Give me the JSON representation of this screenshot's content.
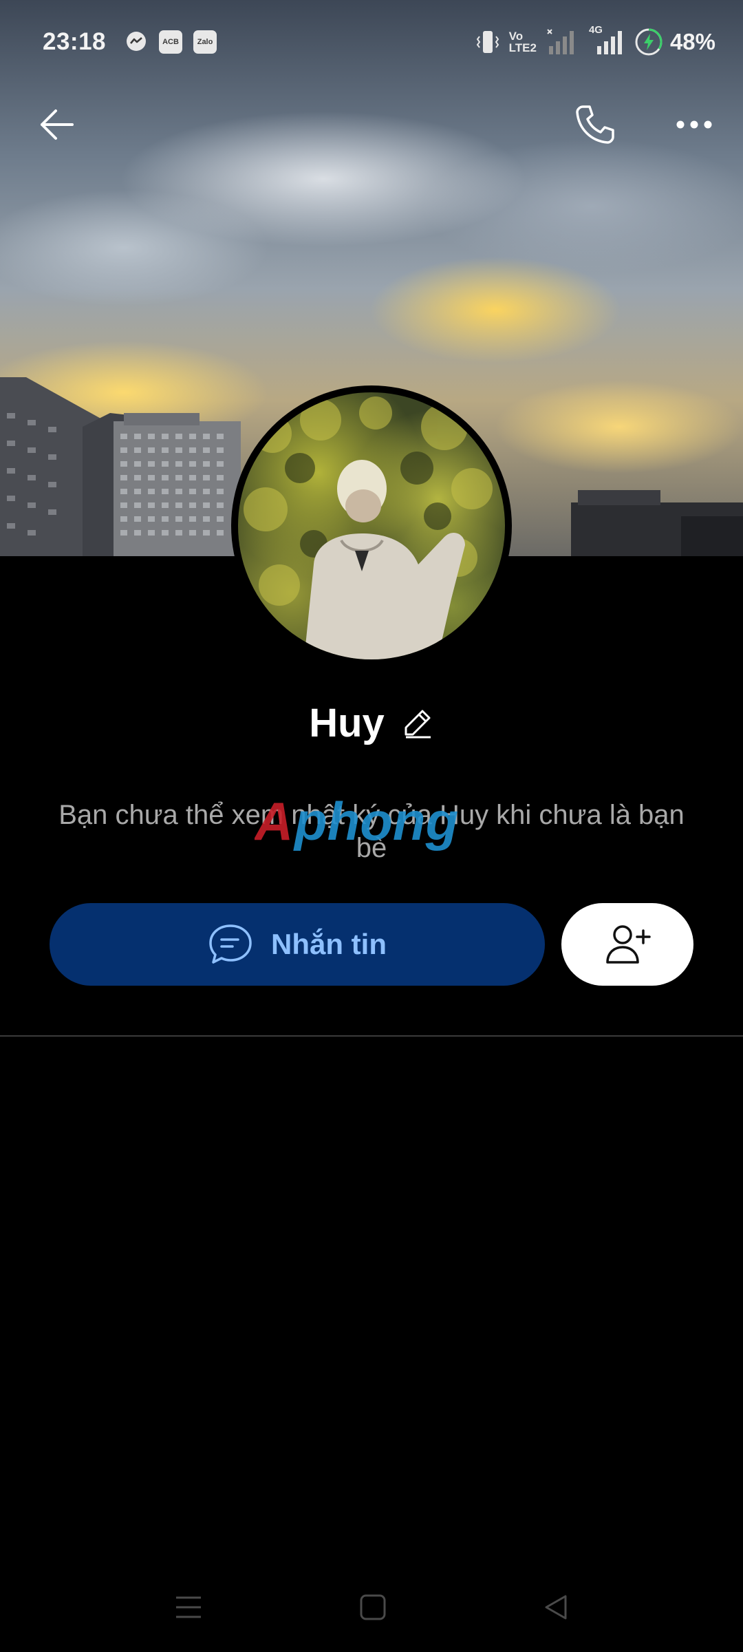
{
  "status_bar": {
    "time": "23:18",
    "notifications": [
      {
        "icon": "messenger-icon"
      },
      {
        "icon": "acb-app-icon",
        "text": "ACB"
      },
      {
        "icon": "zalo-app-icon",
        "text": "Zalo"
      }
    ],
    "volte_label": "Vo",
    "lte_label": "LTE2",
    "network_label": "4G",
    "battery": "48%"
  },
  "top_nav": {
    "back_icon": "back-arrow-icon",
    "call_icon": "phone-icon",
    "more_icon": "more-icon"
  },
  "profile": {
    "name": "Huy",
    "edit_icon": "pencil-icon",
    "notice": "Bạn chưa thể xem nhật ký của Huy khi chưa là bạn bè",
    "watermark": "Aphong"
  },
  "actions": {
    "message_label": "Nhắn tin",
    "message_icon": "chat-bubble-icon",
    "add_friend_icon": "add-friend-icon"
  },
  "colors": {
    "message_button_bg": "#05306f",
    "message_button_text": "#8ec0ff",
    "background": "#000000"
  },
  "android_nav": {
    "recents_icon": "recents-icon",
    "home_icon": "home-icon",
    "back_icon": "nav-back-icon"
  }
}
